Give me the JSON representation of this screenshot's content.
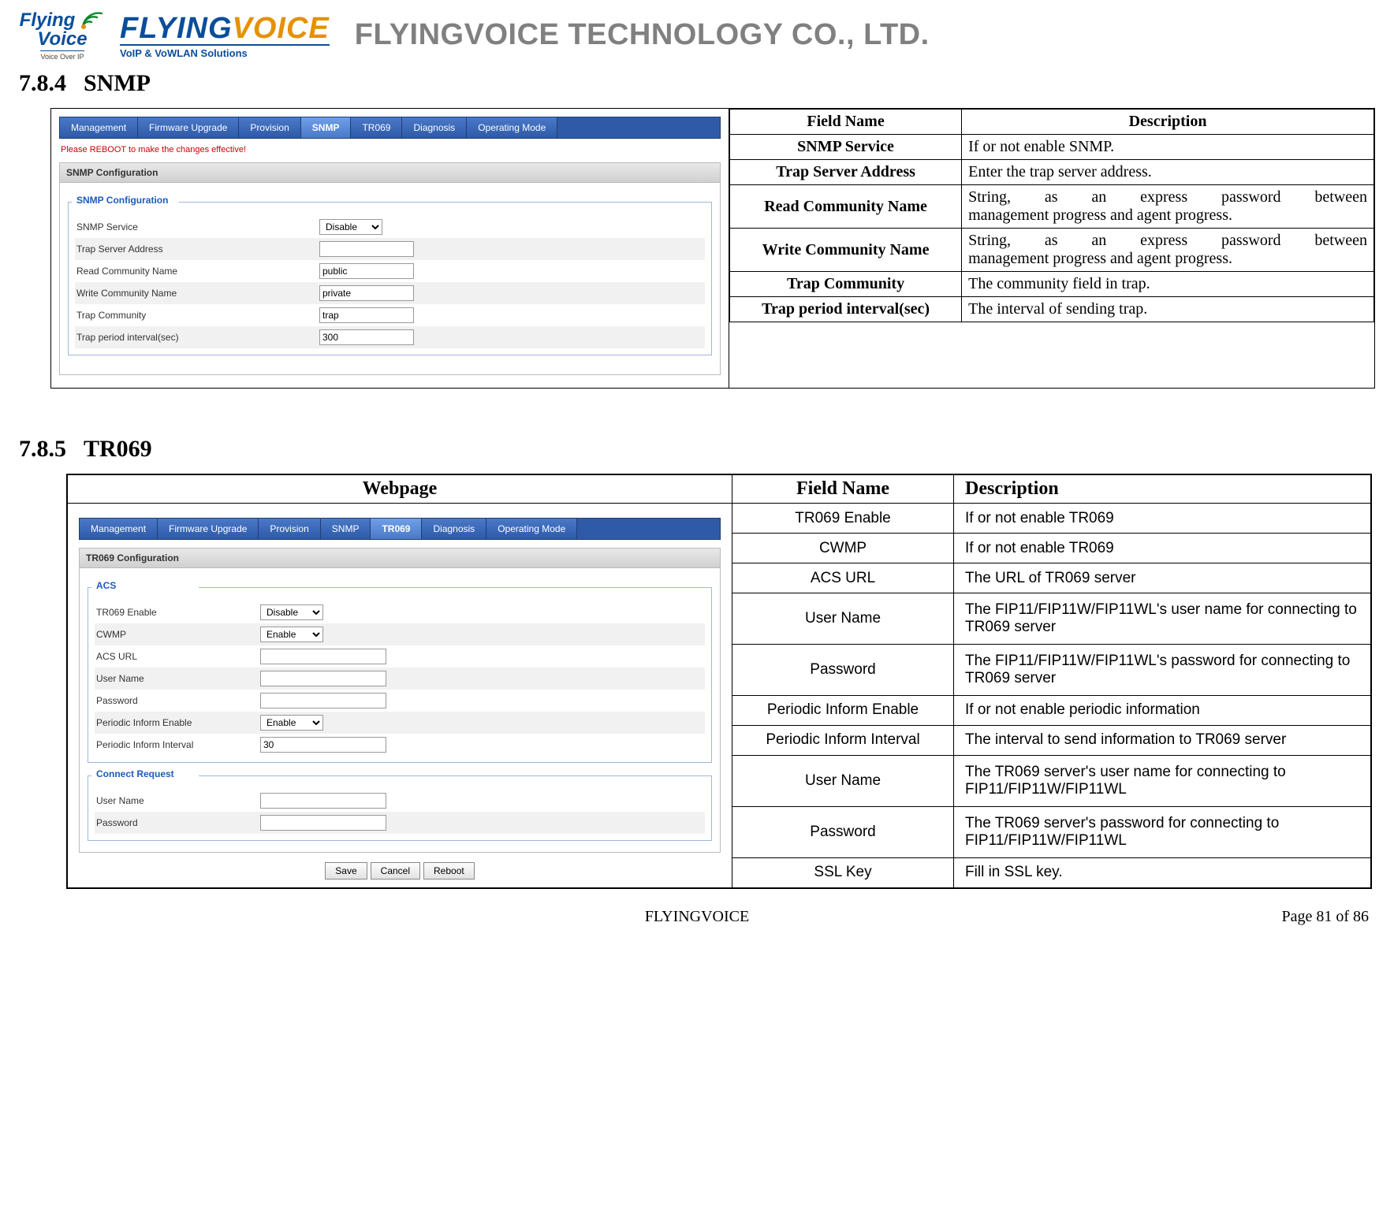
{
  "header": {
    "badge_flying": "Flying",
    "badge_voice": "Voice",
    "badge_sub": "Voice Over IP",
    "logo_fly": "FLYING",
    "logo_voice": "VOICE",
    "logo_sub": "VoIP & VoWLAN Solutions",
    "company": "FLYINGVOICE TECHNOLOGY CO., LTD."
  },
  "sections": {
    "snmp_num": "7.8.4",
    "snmp_title": "SNMP",
    "tr069_num": "7.8.5",
    "tr069_title": "TR069"
  },
  "snmp_shot": {
    "tabs": [
      "Management",
      "Firmware Upgrade",
      "Provision",
      "SNMP",
      "TR069",
      "Diagnosis",
      "Operating Mode"
    ],
    "active_tab": "SNMP",
    "reboot_note": "Please REBOOT to make the changes effective!",
    "panel_title": "SNMP Configuration",
    "fieldset_legend": "SNMP Configuration",
    "rows": [
      {
        "label": "SNMP Service",
        "type": "select",
        "value": "Disable"
      },
      {
        "label": "Trap Server Address",
        "type": "text",
        "value": ""
      },
      {
        "label": "Read Community Name",
        "type": "text",
        "value": "public"
      },
      {
        "label": "Write Community Name",
        "type": "text",
        "value": "private"
      },
      {
        "label": "Trap Community",
        "type": "text",
        "value": "trap"
      },
      {
        "label": "Trap period interval(sec)",
        "type": "text",
        "value": "300"
      }
    ]
  },
  "snmp_spec": {
    "head": [
      "Field Name",
      "Description"
    ],
    "rows": [
      {
        "name": "SNMP Service",
        "desc": "If or not enable SNMP."
      },
      {
        "name": "Trap Server Address",
        "desc": "Enter the trap server address."
      },
      {
        "name": "Read Community Name",
        "desc": "String, as an express password between management progress and agent progress.",
        "justify_first": true
      },
      {
        "name": "Write Community Name",
        "desc": "String, as an express password between management progress and agent progress.",
        "justify_first": true
      },
      {
        "name": "Trap Community",
        "desc": "The community field in trap."
      },
      {
        "name": "Trap period interval(sec)",
        "desc": "The interval of sending trap."
      }
    ]
  },
  "tr069_shot": {
    "tabs": [
      "Management",
      "Firmware Upgrade",
      "Provision",
      "SNMP",
      "TR069",
      "Diagnosis",
      "Operating Mode"
    ],
    "active_tab": "TR069",
    "panel_title": "TR069 Configuration",
    "acs_legend": "ACS",
    "acs_rows": [
      {
        "label": "TR069 Enable",
        "type": "select",
        "value": "Disable"
      },
      {
        "label": "CWMP",
        "type": "select",
        "value": "Enable"
      },
      {
        "label": "ACS URL",
        "type": "text",
        "value": ""
      },
      {
        "label": "User Name",
        "type": "text",
        "value": ""
      },
      {
        "label": "Password",
        "type": "text",
        "value": ""
      },
      {
        "label": "Periodic Inform Enable",
        "type": "select",
        "value": "Enable"
      },
      {
        "label": "Periodic Inform Interval",
        "type": "text",
        "value": "30"
      }
    ],
    "cr_legend": "Connect Request",
    "cr_rows": [
      {
        "label": "User Name",
        "type": "text",
        "value": ""
      },
      {
        "label": "Password",
        "type": "text",
        "value": ""
      }
    ],
    "buttons": [
      "Save",
      "Cancel",
      "Reboot"
    ]
  },
  "tr069_spec": {
    "head": [
      "Webpage",
      "Field Name",
      "Description"
    ],
    "rows": [
      {
        "name": "TR069 Enable",
        "desc": "If or not enable TR069"
      },
      {
        "name": "CWMP",
        "desc": "If or not enable TR069"
      },
      {
        "name": "ACS URL",
        "desc": "The URL of TR069 server"
      },
      {
        "name": "User Name",
        "desc": "The FIP11/FIP11W/FIP11WL's user name for connecting to TR069 server"
      },
      {
        "name": "Password",
        "desc": "The FIP11/FIP11W/FIP11WL's password for connecting to TR069 server"
      },
      {
        "name": "Periodic Inform Enable",
        "desc": "If or not enable periodic information"
      },
      {
        "name": "Periodic Inform Interval",
        "desc": "The interval to send information to TR069 server"
      },
      {
        "name": "User Name",
        "desc": "The TR069 server's user name for connecting to FIP11/FIP11W/FIP11WL"
      },
      {
        "name": "Password",
        "desc": "The TR069 server's password for connecting to FIP11/FIP11W/FIP11WL"
      },
      {
        "name": "SSL Key",
        "desc": "Fill in SSL key."
      }
    ]
  },
  "footer": {
    "center": "FLYINGVOICE",
    "right": "Page 81 of 86"
  }
}
